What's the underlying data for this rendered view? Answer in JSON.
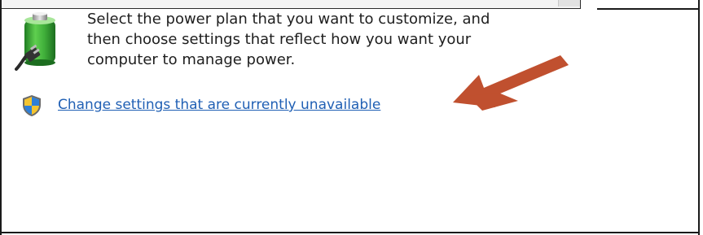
{
  "description": {
    "lines": [
      "Select the power plan that you want to customize, and",
      "then choose settings that reflect how you want your",
      "computer to manage power."
    ]
  },
  "link": {
    "label": "Change settings that are currently unavailable"
  },
  "icons": {
    "battery": "battery-power-plug-icon",
    "shield": "uac-shield-icon",
    "annotation": "red-arrow-icon"
  },
  "colors": {
    "link": "#1f5fb4",
    "arrow": "#c0502f",
    "battery_green": "#3fae3a"
  }
}
